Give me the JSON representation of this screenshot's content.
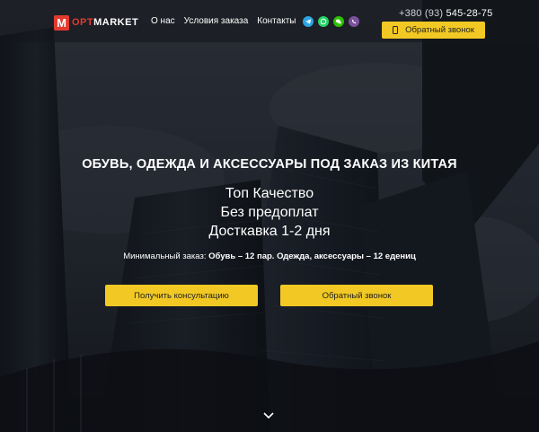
{
  "header": {
    "logo": {
      "mark": "M",
      "part1": "OPT",
      "part2": "MARKET"
    },
    "nav": [
      "О нас",
      "Условия заказа",
      "Контакты"
    ],
    "messengers": [
      {
        "name": "telegram-icon",
        "color": "#2ca5e0"
      },
      {
        "name": "whatsapp-icon",
        "color": "#25d366"
      },
      {
        "name": "wechat-icon",
        "color": "#2dc100"
      },
      {
        "name": "viber-icon",
        "color": "#7b519d"
      }
    ],
    "phone": {
      "code": "+380 (93)",
      "number": "545-28-75"
    },
    "callback_label": "Обратный звонок"
  },
  "hero": {
    "title": "ОБУВЬ, ОДЕЖДА И АКСЕССУАРЫ ПОД ЗАКАЗ ИЗ КИТАЯ",
    "bullets": [
      "Топ Качество",
      "Без предоплат",
      "Досткавка 1-2 дня"
    ],
    "min_order_label": "Минимальный заказ:",
    "min_order_value": "Обувь – 12 пар. Одежда, аксессуары – 12 едениц",
    "consult_button": "Получить консультацию",
    "callback_button": "Обратный звонок"
  },
  "colors": {
    "accent": "#f2c924",
    "brand_red": "#e23a2e"
  }
}
